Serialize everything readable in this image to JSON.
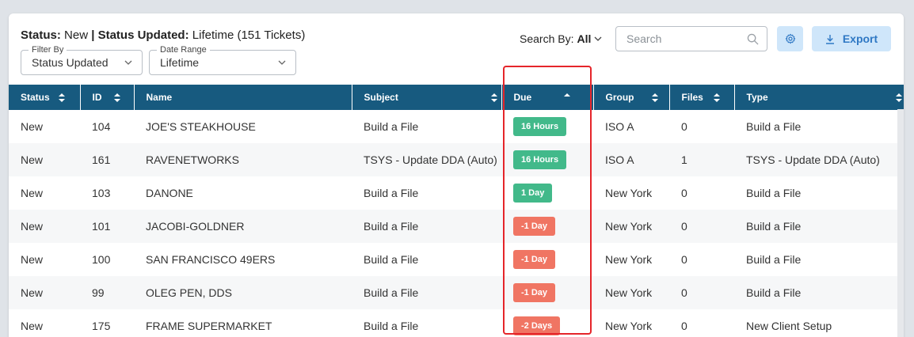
{
  "header": {
    "title_status_label": "Status:",
    "title_status_value": "New",
    "title_separator": "|",
    "title_updated_label": "Status Updated:",
    "title_updated_value": "Lifetime (151 Tickets)"
  },
  "filters": {
    "filter_by": {
      "label": "Filter By",
      "value": "Status Updated"
    },
    "date_range": {
      "label": "Date Range",
      "value": "Lifetime"
    }
  },
  "search": {
    "search_by_label": "Search By:",
    "search_by_value": "All",
    "placeholder": "Search",
    "value": ""
  },
  "toolbar": {
    "settings_icon": "gear-icon",
    "export_label": "Export",
    "export_icon": "download-icon"
  },
  "table": {
    "columns": [
      "Status",
      "ID",
      "Name",
      "Subject",
      "Due",
      "Group",
      "Files",
      "Type"
    ],
    "sorted_column": "Due",
    "sort_direction": "ascending",
    "rows": [
      {
        "status": "New",
        "id": "104",
        "name": "JOE'S STEAKHOUSE",
        "subject": "Build a File",
        "due": "16 Hours",
        "due_state": "pos",
        "group": "ISO A",
        "files": "0",
        "type": "Build a File"
      },
      {
        "status": "New",
        "id": "161",
        "name": "RAVENETWORKS",
        "subject": "TSYS - Update DDA (Auto)",
        "due": "16 Hours",
        "due_state": "pos",
        "group": "ISO A",
        "files": "1",
        "type": "TSYS - Update DDA (Auto)"
      },
      {
        "status": "New",
        "id": "103",
        "name": "DANONE",
        "subject": "Build a File",
        "due": "1 Day",
        "due_state": "pos",
        "group": "New York",
        "files": "0",
        "type": "Build a File"
      },
      {
        "status": "New",
        "id": "101",
        "name": "JACOBI-GOLDNER",
        "subject": "Build a File",
        "due": "-1 Day",
        "due_state": "neg",
        "group": "New York",
        "files": "0",
        "type": "Build a File"
      },
      {
        "status": "New",
        "id": "100",
        "name": "SAN FRANCISCO 49ERS",
        "subject": "Build a File",
        "due": "-1 Day",
        "due_state": "neg",
        "group": "New York",
        "files": "0",
        "type": "Build a File"
      },
      {
        "status": "New",
        "id": "99",
        "name": "OLEG PEN, DDS",
        "subject": "Build a File",
        "due": "-1 Day",
        "due_state": "neg",
        "group": "New York",
        "files": "0",
        "type": "Build a File"
      },
      {
        "status": "New",
        "id": "175",
        "name": "FRAME SUPERMARKET",
        "subject": "Build a File",
        "due": "-2 Days",
        "due_state": "neg",
        "group": "New York",
        "files": "0",
        "type": "New Client Setup"
      }
    ]
  },
  "colors": {
    "header_bg": "#175a7f",
    "due_positive": "#42b98a",
    "due_negative": "#f07563",
    "highlight_border": "#e5252a",
    "button_bg": "#cfe6fa",
    "button_text": "#2f78c4"
  }
}
